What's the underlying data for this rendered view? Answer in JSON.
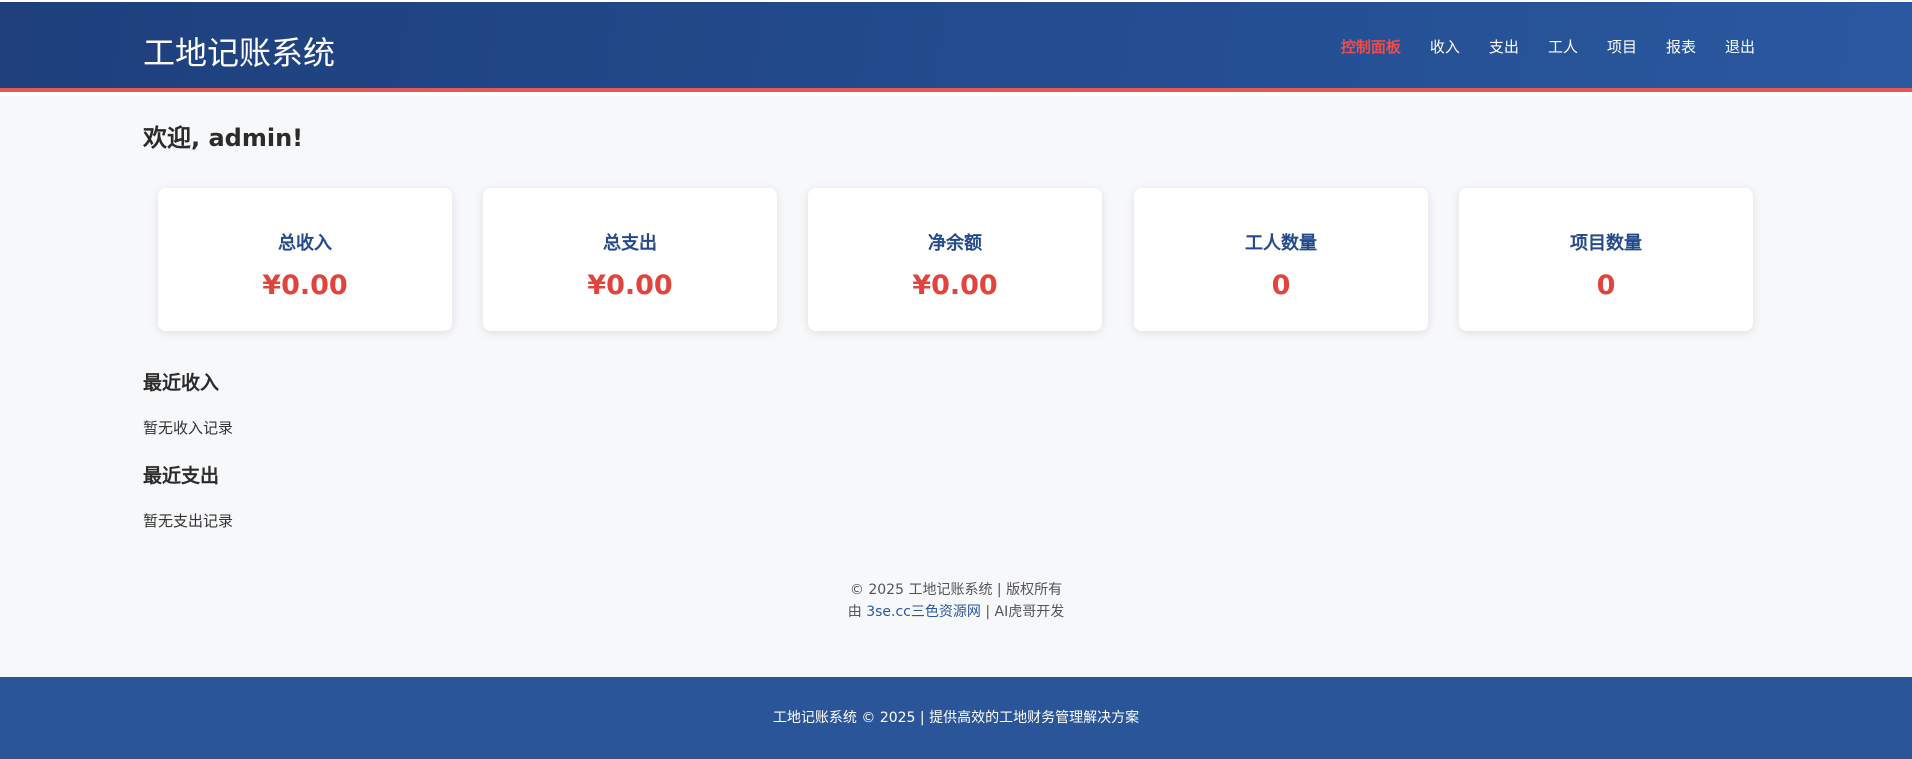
{
  "header": {
    "brand": "工地记账系统",
    "nav": [
      {
        "label": "控制面板",
        "active": true
      },
      {
        "label": "收入"
      },
      {
        "label": "支出"
      },
      {
        "label": "工人"
      },
      {
        "label": "项目"
      },
      {
        "label": "报表"
      },
      {
        "label": "退出"
      }
    ]
  },
  "main": {
    "welcome": "欢迎, admin!",
    "cards": [
      {
        "label": "总收入",
        "value": "¥0.00"
      },
      {
        "label": "总支出",
        "value": "¥0.00"
      },
      {
        "label": "净余额",
        "value": "¥0.00"
      },
      {
        "label": "工人数量",
        "value": "0"
      },
      {
        "label": "项目数量",
        "value": "0"
      }
    ],
    "recent_income": {
      "title": "最近收入",
      "empty": "暂无收入记录"
    },
    "recent_expense": {
      "title": "最近支出",
      "empty": "暂无支出记录"
    },
    "copyright": {
      "line1": "© 2025 工地记账系统 | 版权所有",
      "line2_prefix": "由 ",
      "line2_link": "3se.cc三色资源网",
      "line2_suffix": " | AI虎哥开发"
    }
  },
  "footer": {
    "text": "工地记账系统 © 2025 | 提供高效的工地财务管理解决方案"
  },
  "colors": {
    "header_bg": "#234b8d",
    "accent_red": "#e0443c",
    "card_label": "#244a8c",
    "footer_bg": "#2a5599"
  }
}
